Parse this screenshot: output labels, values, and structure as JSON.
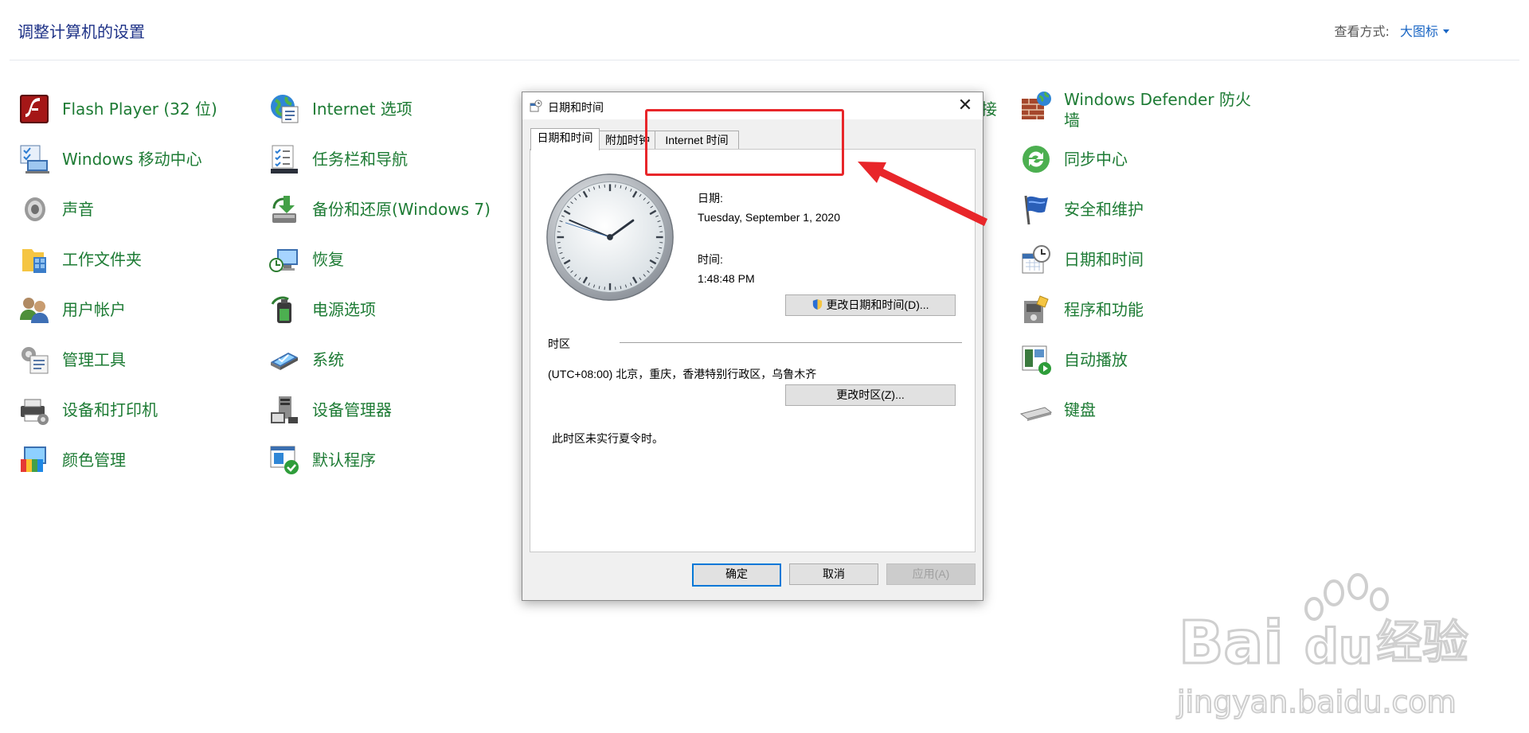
{
  "control_panel": {
    "title": "调整计算机的设置",
    "view_by_label": "查看方式:",
    "view_by_value": "大图标",
    "items": [
      {
        "label": "Flash Player (32 位)",
        "icon": "flash-player-icon"
      },
      {
        "label": "Windows 移动中心",
        "icon": "mobility-center-icon"
      },
      {
        "label": "声音",
        "icon": "speaker-icon"
      },
      {
        "label": "工作文件夹",
        "icon": "work-folders-icon"
      },
      {
        "label": "用户帐户",
        "icon": "user-accounts-icon"
      },
      {
        "label": "管理工具",
        "icon": "admin-tools-icon"
      },
      {
        "label": "设备和打印机",
        "icon": "printer-icon"
      },
      {
        "label": "颜色管理",
        "icon": "color-management-icon"
      },
      {
        "label": "Internet 选项",
        "icon": "internet-options-icon"
      },
      {
        "label": "任务栏和导航",
        "icon": "taskbar-icon"
      },
      {
        "label": "备份和还原(Windows 7)",
        "icon": "backup-restore-icon"
      },
      {
        "label": "恢复",
        "icon": "recovery-icon"
      },
      {
        "label": "电源选项",
        "icon": "power-options-icon"
      },
      {
        "label": "系统",
        "icon": "system-icon"
      },
      {
        "label": "设备管理器",
        "icon": "device-manager-icon"
      },
      {
        "label": "默认程序",
        "icon": "default-programs-icon"
      },
      {
        "label": "Windows Defender 防火墙",
        "icon": "firewall-icon"
      },
      {
        "label": "同步中心",
        "icon": "sync-center-icon"
      },
      {
        "label": "安全和维护",
        "icon": "security-maintenance-flag-icon"
      },
      {
        "label": "日期和时间",
        "icon": "date-time-icon"
      },
      {
        "label": "程序和功能",
        "icon": "programs-features-icon"
      },
      {
        "label": "自动播放",
        "icon": "autoplay-icon"
      },
      {
        "label": "键盘",
        "icon": "keyboard-icon"
      }
    ],
    "partial_label": "接"
  },
  "dialog": {
    "title": "日期和时间",
    "tabs": [
      "日期和时间",
      "附加时钟",
      "Internet 时间"
    ],
    "date_label": "日期:",
    "date_value": "Tuesday, September 1, 2020",
    "time_label": "时间:",
    "time_value": "1:48:48 PM",
    "change_datetime_button": "更改日期和时间(D)...",
    "timezone_heading": "时区",
    "timezone_value": "(UTC+08:00) 北京，重庆，香港特别行政区，乌鲁木齐",
    "change_timezone_button": "更改时区(Z)...",
    "dst_note": "此时区未实行夏令时。",
    "ok_button": "确定",
    "cancel_button": "取消",
    "apply_button": "应用(A)",
    "clock": {
      "hour": 1,
      "minute": 48,
      "second": 48
    }
  },
  "watermark": {
    "brand": "Bai",
    "brand2": "du",
    "product": "经验",
    "url": "jingyan.baidu.com"
  },
  "colors": {
    "label_green": "#1d7b34",
    "title_blue": "#1e3287",
    "link_blue": "#1a66c4",
    "annotation_red": "#e8262a",
    "focus_blue": "#0078d7"
  }
}
